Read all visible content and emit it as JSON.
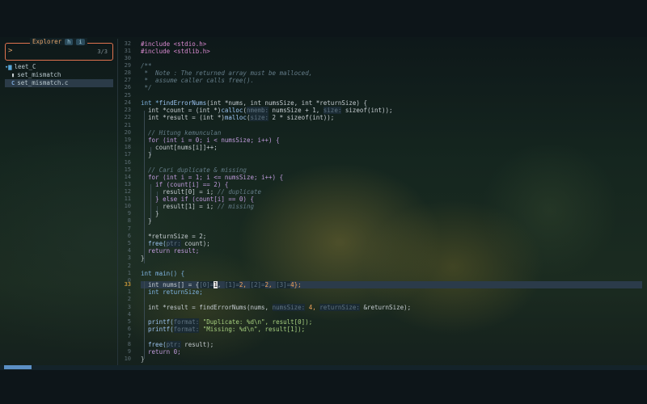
{
  "explorer": {
    "title": "Explorer",
    "key_hidden": "h",
    "key_ignored": "i",
    "prompt": ">",
    "count": "3/3"
  },
  "tree": [
    {
      "label": "leet_C",
      "icon": "folder-icon"
    },
    {
      "label": "set_mismatch",
      "icon": "file-icon"
    },
    {
      "label": "set_mismatch.c",
      "icon": "c-file-icon",
      "selected": true
    }
  ],
  "line_numbers": [
    "32",
    "31",
    "30",
    "29",
    "28",
    "27",
    "26",
    "25",
    "24",
    "23",
    "22",
    "21",
    "20",
    "19",
    "18",
    "17",
    "16",
    "15",
    "14",
    "13",
    "12",
    "11",
    "10",
    "9",
    "8",
    "7",
    "6",
    "5",
    "4",
    "3",
    "2",
    "1",
    "0",
    "33",
    "1",
    "2",
    "3",
    "4",
    "5",
    "6",
    "7",
    "8",
    "9",
    "10",
    "11"
  ],
  "current_line": "33",
  "code": {
    "l0": "#include <stdio.h>",
    "l1": "#include <stdlib.h>",
    "l3": "/**",
    "l4": " *  Note : The returned array must be malloced,",
    "l5": " *  assume caller calls free().",
    "l6": " */",
    "l8a": "int *",
    "l8b": "findErrorNums",
    "l8c": "(int *nums, int numsSize, int *returnSize) {",
    "l9a": "  int *count = (int *)",
    "l9b": "calloc",
    "l9c": "(",
    "l9h1": "nmemb:",
    "l9d": " numsSize + 1, ",
    "l9h2": "size:",
    "l9e": " sizeof(int));",
    "l10a": "  int *result = (int *)",
    "l10b": "malloc",
    "l10c": "(",
    "l10h": "size:",
    "l10d": " 2 * sizeof(int));",
    "l12": "  // Hitung kemunculan",
    "l13": "  for (int i = 0; i < numsSize; i++) {",
    "l14": "    count[nums[i]]++;",
    "l15": "  }",
    "l17": "  // Cari duplicate & missing",
    "l18": "  for (int i = 1; i <= numsSize; i++) {",
    "l19": "    if (count[i] == 2) {",
    "l20a": "      result[0] = i; ",
    "l20b": "// duplicate",
    "l21": "    } else if (count[i] == 0) {",
    "l22a": "      result[1] = i; ",
    "l22b": "// missing",
    "l23": "    }",
    "l24": "  }",
    "l26": "  *returnSize = 2;",
    "l27a": "  free(",
    "l27h": "ptr:",
    "l27b": " count);",
    "l28": "  return result;",
    "l29": "}",
    "l31": "int main() {",
    "l32a": "  int nums[] = {",
    "l32h0": "[0]=",
    "l32cur": "1",
    "l32b": ", ",
    "l32h1": "[1]=",
    "l32c": "2, ",
    "l32h2": "[2]=",
    "l32d": "2, ",
    "l32h3": "[3]=",
    "l32e": "4};",
    "l33": "  int returnSize;",
    "l35a": "  int *result = findErrorNums(nums, ",
    "l35h1": "numsSize:",
    "l35b": " 4, ",
    "l35h2": "returnSize:",
    "l35c": " &returnSize);",
    "l37a": "  printf(",
    "l37h": "format:",
    "l37b": " \"Duplicate: %d\\n\", result[0]);",
    "l38a": "  printf(",
    "l38h": "format:",
    "l38b": " \"Missing: %d\\n\", result[1]);",
    "l40a": "  free(",
    "l40h": "ptr:",
    "l40b": " result);",
    "l41": "  return 0;",
    "l42": "}"
  },
  "colors": {
    "accent": "#e0734f",
    "keyword": "#c09bdc",
    "type": "#7fb3e0",
    "string": "#a6cf7f",
    "number": "#f0a35a",
    "comment": "#647c88",
    "current_line_number": "#f0b040"
  }
}
